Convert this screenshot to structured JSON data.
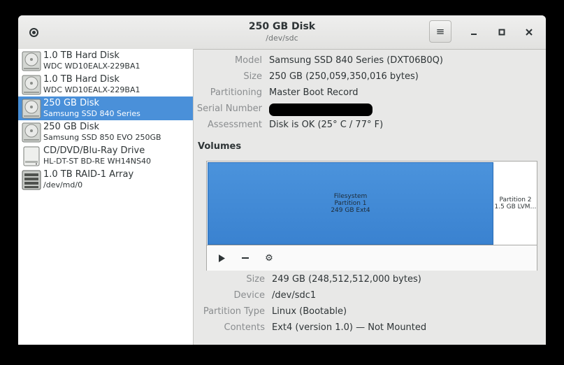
{
  "window": {
    "title": "250 GB Disk",
    "subtitle": "/dev/sdc"
  },
  "titlebar": {
    "menu_icon": "≡",
    "minimize_icon": "—",
    "maximize_icon": "□",
    "close_icon": "✕"
  },
  "sidebar": {
    "devices": [
      {
        "name": "1.0 TB Hard Disk",
        "sub": "WDC WD10EALX-229BA1",
        "icon": "hard-disk-icon"
      },
      {
        "name": "1.0 TB Hard Disk",
        "sub": "WDC WD10EALX-229BA1",
        "icon": "hard-disk-icon"
      },
      {
        "name": "250 GB Disk",
        "sub": "Samsung SSD 840 Series",
        "icon": "hard-disk-icon",
        "selected": true
      },
      {
        "name": "250 GB Disk",
        "sub": "Samsung SSD 850 EVO 250GB",
        "icon": "hard-disk-icon"
      },
      {
        "name": "CD/DVD/Blu-Ray Drive",
        "sub": "HL-DT-ST BD-RE  WH14NS40",
        "icon": "optical-drive-icon"
      },
      {
        "name": "1.0 TB RAID-1 Array",
        "sub": "/dev/md/0",
        "icon": "raid-array-icon"
      }
    ]
  },
  "disk": {
    "model_label": "Model",
    "model": "Samsung SSD 840 Series (DXT06B0Q)",
    "size_label": "Size",
    "size": "250 GB (250,059,350,016 bytes)",
    "partitioning_label": "Partitioning",
    "partitioning": "Master Boot Record",
    "serial_label": "Serial Number",
    "assessment_label": "Assessment",
    "assessment": "Disk is OK (25° C / 77° F)"
  },
  "volumes": {
    "title": "Volumes",
    "partition1": {
      "line1": "Filesystem",
      "line2": "Partition 1",
      "line3": "249 GB Ext4"
    },
    "partition2": {
      "line1": "Partition 2",
      "line2": "1.5 GB LVM…"
    },
    "toolbar": {
      "play_icon": "▶",
      "remove_icon": "—",
      "settings_icon": "⚙"
    }
  },
  "selected_volume": {
    "size_label": "Size",
    "size": "249 GB (248,512,512,000 bytes)",
    "device_label": "Device",
    "device": "/dev/sdc1",
    "type_label": "Partition Type",
    "type": "Linux (Bootable)",
    "contents_label": "Contents",
    "contents": "Ext4 (version 1.0) — Not Mounted"
  },
  "colors": {
    "accent": "#4a90d9",
    "partition_fill": "#3e86d3"
  }
}
